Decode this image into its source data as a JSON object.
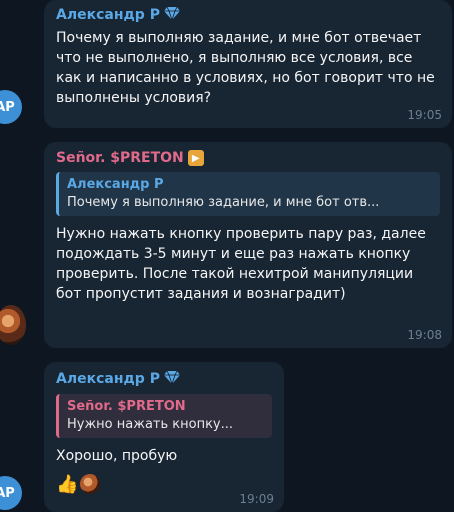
{
  "messages": [
    {
      "sender": "Александр Р",
      "text": "Почему я выполняю задание, и мне бот отвечает что не выполнено, я выполняю все условия, все как и написанно в условиях, но бот говорит что не выполнены условия?",
      "time": "19:05",
      "avatar": "АР"
    },
    {
      "sender": "Señor. $PRETON",
      "quote": {
        "sender": "Александр Р",
        "text": "Почему я выполняю задание, и мне бот отв..."
      },
      "text": "Нужно нажать кнопку проверить пару раз, далее подождать 3-5 минут и еще раз нажать кнопку проверить. После такой нехитрой манипуляции бот пропустит задания и вознаградит)",
      "time": "19:08"
    },
    {
      "sender": "Александр Р",
      "quote": {
        "sender": "Señor. $PRETON",
        "text": "Нужно нажать кнопку..."
      },
      "text": "Хорошо, пробую",
      "time": "19:09",
      "avatar": "АР",
      "reactions": [
        "👍"
      ]
    }
  ],
  "icons": {
    "verified": "diamond-verified-icon",
    "badge": "boost-badge-icon"
  },
  "colors": {
    "background": "#0e1621",
    "bubble": "#182533",
    "name_blue": "#5aa9e6",
    "name_pink": "#e06a8a"
  }
}
